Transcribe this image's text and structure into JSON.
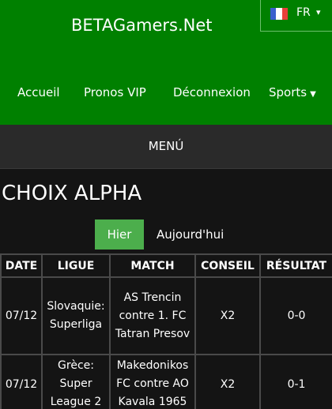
{
  "header": {
    "site_title": "BETAGamers.Net",
    "language": {
      "label": "FR",
      "flag_colors": [
        "#3a5fcd",
        "#ffffff",
        "#e8403a"
      ]
    },
    "nav": [
      {
        "label": "Accueil"
      },
      {
        "label": "Pronos VIP"
      },
      {
        "label": "Déconnexion"
      },
      {
        "label": "Sports"
      }
    ]
  },
  "menu_label": "MENÚ",
  "page_title": "CHOIX ALPHA",
  "tabs": [
    {
      "label": "Hier",
      "active": true
    },
    {
      "label": "Aujourd'hui",
      "active": false
    }
  ],
  "table": {
    "headers": [
      "DATE",
      "LIGUE",
      "MATCH",
      "CONSEIL",
      "RÉSULTAT"
    ],
    "rows": [
      {
        "date": "07/12",
        "ligue": "Slovaquie: Superliga",
        "match": "AS Trencin contre 1. FC Tatran Presov",
        "conseil": "X2",
        "resultat": "0-0"
      },
      {
        "date": "07/12",
        "ligue": "Grèce: Super League 2",
        "match": "Makedonikos FC contre AO Kavala 1965",
        "conseil": "X2",
        "resultat": "0-1"
      }
    ]
  },
  "colors": {
    "header_green": "#008000",
    "active_tab_green": "#4cae4c",
    "menu_bar": "#2a2a2a",
    "background": "#141414"
  }
}
